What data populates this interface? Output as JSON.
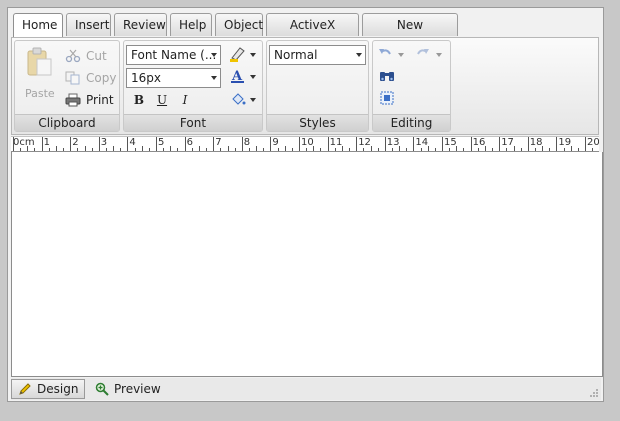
{
  "tabs": [
    {
      "label": "Home",
      "active": true
    },
    {
      "label": "Insert"
    },
    {
      "label": "Review"
    },
    {
      "label": "Help"
    },
    {
      "label": "Object"
    },
    {
      "label": "ActiveX Object"
    },
    {
      "label": "New Document"
    }
  ],
  "clipboard": {
    "paste_label": "Paste",
    "cut_label": "Cut",
    "copy_label": "Copy",
    "print_label": "Print",
    "group_label": "Clipboard"
  },
  "font": {
    "font_name_value": "Font Name (...",
    "font_size_value": "16px",
    "bold_label": "B",
    "underline_label": "U",
    "italic_label": "I",
    "group_label": "Font"
  },
  "styles": {
    "style_value": "Normal",
    "group_label": "Styles"
  },
  "editing": {
    "group_label": "Editing"
  },
  "ruler": {
    "unit_label": "0cm",
    "marks": [
      "1",
      "2",
      "3",
      "4",
      "5",
      "6",
      "7",
      "8",
      "9",
      "10",
      "11",
      "12",
      "13",
      "14",
      "15",
      "16",
      "17",
      "18",
      "19",
      "20"
    ]
  },
  "modes": {
    "design_label": "Design",
    "preview_label": "Preview"
  },
  "colors": {
    "highlight": "#f0c400",
    "font_color": "#2a4fb0",
    "accent_blue": "#3b6fc6"
  },
  "icons": [
    "paste-icon",
    "cut-icon",
    "copy-icon",
    "print-icon",
    "highlighter-icon",
    "font-color-icon",
    "fill-color-icon",
    "undo-icon",
    "redo-icon",
    "find-icon",
    "select-all-icon",
    "pencil-icon",
    "magnifier-icon"
  ]
}
